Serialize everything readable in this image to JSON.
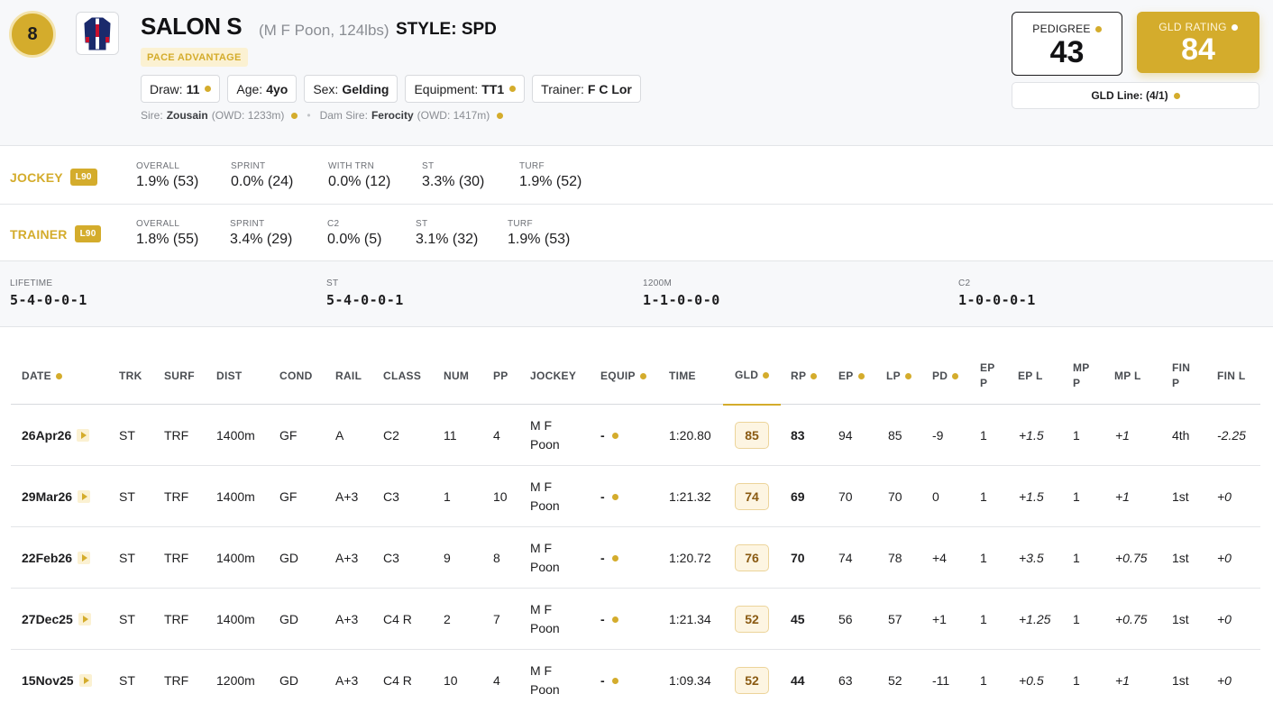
{
  "horse": {
    "number": "8",
    "name": "SALON S",
    "meta": "(M F Poon, 124lbs)",
    "style": "STYLE: SPD",
    "badge": "PACE ADVANTAGE",
    "chips": [
      {
        "key": "Draw:",
        "value": "11",
        "dot": true
      },
      {
        "key": "Age:",
        "value": "4yo",
        "dot": false
      },
      {
        "key": "Sex:",
        "value": "Gelding",
        "dot": false
      },
      {
        "key": "Equipment:",
        "value": "TT1",
        "dot": true
      },
      {
        "key": "Trainer:",
        "value": "F C Lor",
        "dot": false
      }
    ],
    "sire_label": "Sire:",
    "sire": "Zousain",
    "sire_owd": "(OWD: 1233m)",
    "dam_sire_label": "Dam Sire:",
    "dam_sire": "Ferocity",
    "dam_sire_owd": "(OWD: 1417m)",
    "silks_colors": {
      "navy": "#1a2a6c",
      "red": "#c8102e",
      "white": "#ffffff"
    }
  },
  "ratings": {
    "pedigree_label": "PEDIGREE",
    "pedigree_value": "43",
    "gld_label": "GLD RATING",
    "gld_value": "84",
    "gld_line": "GLD Line: (4/1)"
  },
  "jockey": {
    "title": "JOCKEY",
    "tag": "L90",
    "stats": [
      {
        "k": "OVERALL",
        "v": "1.9% (53)"
      },
      {
        "k": "SPRINT",
        "v": "0.0% (24)"
      },
      {
        "k": "WITH TRN",
        "v": "0.0% (12)"
      },
      {
        "k": "ST",
        "v": "3.3% (30)"
      },
      {
        "k": "TURF",
        "v": "1.9% (52)"
      }
    ]
  },
  "trainer": {
    "title": "TRAINER",
    "tag": "L90",
    "stats": [
      {
        "k": "OVERALL",
        "v": "1.8% (55)"
      },
      {
        "k": "SPRINT",
        "v": "3.4% (29)"
      },
      {
        "k": "C2",
        "v": "0.0% (5)"
      },
      {
        "k": "ST",
        "v": "3.1% (32)"
      },
      {
        "k": "TURF",
        "v": "1.9% (53)"
      }
    ]
  },
  "records": [
    {
      "k": "LIFETIME",
      "v": "5-4-0-0-1"
    },
    {
      "k": "ST",
      "v": "5-4-0-0-1"
    },
    {
      "k": "1200M",
      "v": "1-1-0-0-0"
    },
    {
      "k": "C2",
      "v": "1-0-0-0-1"
    }
  ],
  "table": {
    "headers": {
      "date": "DATE",
      "trk": "TRK",
      "surf": "SURF",
      "dist": "DIST",
      "cond": "COND",
      "rail": "RAIL",
      "class": "CLASS",
      "num": "NUM",
      "pp": "PP",
      "jockey": "JOCKEY",
      "equip": "EQUIP",
      "time": "TIME",
      "gld": "GLD",
      "rp": "RP",
      "ep": "EP",
      "lp": "LP",
      "pd": "PD",
      "epp1": "EP",
      "epp2": "P",
      "epl": "EP L",
      "mpp1": "MP",
      "mpp2": "P",
      "mpl": "MP L",
      "finp1": "FIN",
      "finp2": "P",
      "finl": "FIN L"
    },
    "rows": [
      {
        "date": "26Apr26",
        "trk": "ST",
        "surf": "TRF",
        "dist": "1400m",
        "cond": "GF",
        "rail": "A",
        "class": "C2",
        "num": "11",
        "pp": "4",
        "jockey1": "M F",
        "jockey2": "Poon",
        "equip": "-",
        "time": "1:20.80",
        "gld": "85",
        "rp": "83",
        "ep": "94",
        "lp": "85",
        "pd": "-9",
        "epp": "1",
        "epl": "+1.5",
        "mpp": "1",
        "mpl": "+1",
        "finp": "4th",
        "finl": "-2.25"
      },
      {
        "date": "29Mar26",
        "trk": "ST",
        "surf": "TRF",
        "dist": "1400m",
        "cond": "GF",
        "rail": "A+3",
        "class": "C3",
        "num": "1",
        "pp": "10",
        "jockey1": "M F",
        "jockey2": "Poon",
        "equip": "-",
        "time": "1:21.32",
        "gld": "74",
        "rp": "69",
        "ep": "70",
        "lp": "70",
        "pd": "0",
        "epp": "1",
        "epl": "+1.5",
        "mpp": "1",
        "mpl": "+1",
        "finp": "1st",
        "finl": "+0"
      },
      {
        "date": "22Feb26",
        "trk": "ST",
        "surf": "TRF",
        "dist": "1400m",
        "cond": "GD",
        "rail": "A+3",
        "class": "C3",
        "num": "9",
        "pp": "8",
        "jockey1": "M F",
        "jockey2": "Poon",
        "equip": "-",
        "time": "1:20.72",
        "gld": "76",
        "rp": "70",
        "ep": "74",
        "lp": "78",
        "pd": "+4",
        "epp": "1",
        "epl": "+3.5",
        "mpp": "1",
        "mpl": "+0.75",
        "finp": "1st",
        "finl": "+0"
      },
      {
        "date": "27Dec25",
        "trk": "ST",
        "surf": "TRF",
        "dist": "1400m",
        "cond": "GD",
        "rail": "A+3",
        "class": "C4 R",
        "num": "2",
        "pp": "7",
        "jockey1": "M F",
        "jockey2": "Poon",
        "equip": "-",
        "time": "1:21.34",
        "gld": "52",
        "rp": "45",
        "ep": "56",
        "lp": "57",
        "pd": "+1",
        "epp": "1",
        "epl": "+1.25",
        "mpp": "1",
        "mpl": "+0.75",
        "finp": "1st",
        "finl": "+0"
      },
      {
        "date": "15Nov25",
        "trk": "ST",
        "surf": "TRF",
        "dist": "1200m",
        "cond": "GD",
        "rail": "A+3",
        "class": "C4 R",
        "num": "10",
        "pp": "4",
        "jockey1": "M F",
        "jockey2": "Poon",
        "equip": "-",
        "time": "1:09.34",
        "gld": "52",
        "rp": "44",
        "ep": "63",
        "lp": "52",
        "pd": "-11",
        "epp": "1",
        "epl": "+0.5",
        "mpp": "1",
        "mpl": "+1",
        "finp": "1st",
        "finl": "+0"
      }
    ]
  },
  "colors": {
    "accent": "#d4ac2c",
    "accent_light": "#fbf1d2",
    "border": "#e3e5e8"
  }
}
